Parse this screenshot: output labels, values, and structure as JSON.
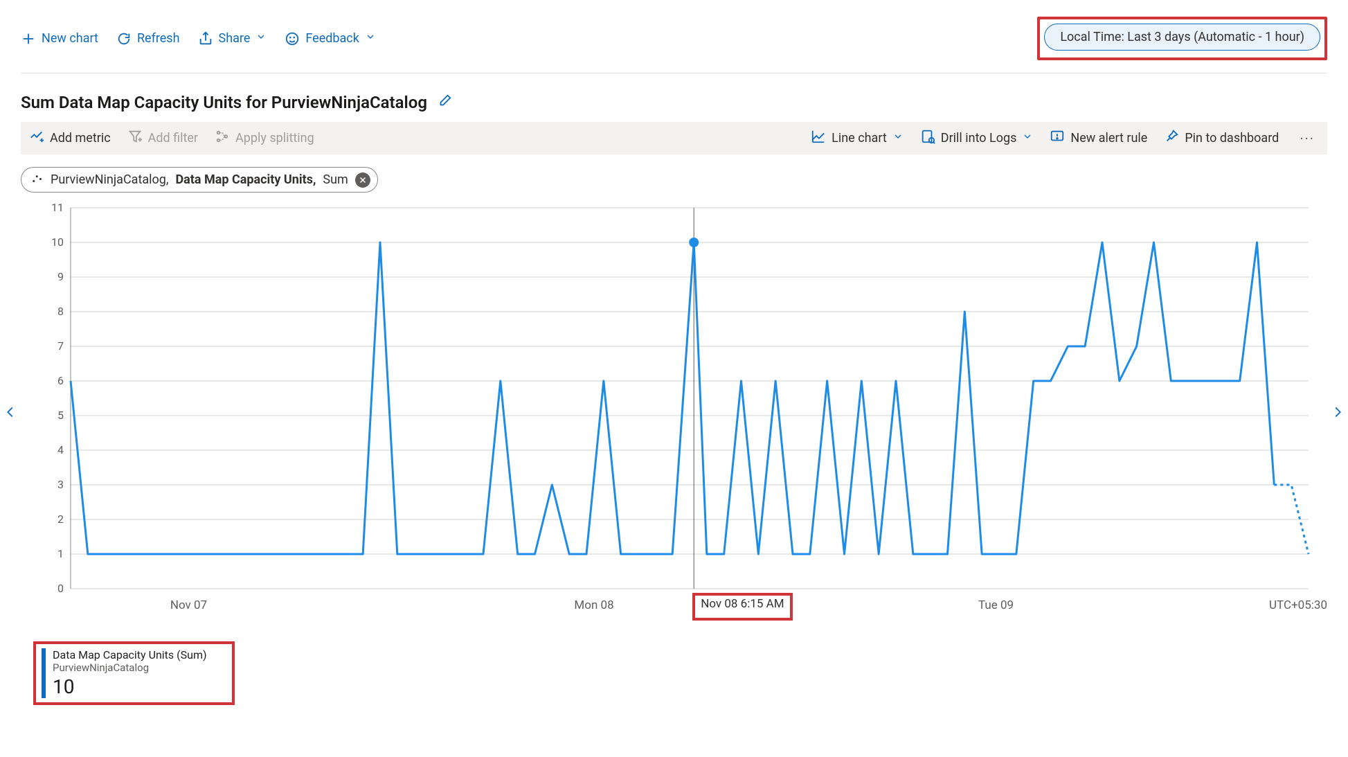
{
  "colors": {
    "accent": "#0f6cbd",
    "danger_box": "#d13438",
    "grid": "#d2d0ce",
    "line": "#1e8be6"
  },
  "top_toolbar": {
    "new_chart_label": "New chart",
    "refresh_label": "Refresh",
    "share_label": "Share",
    "feedback_label": "Feedback",
    "time_picker_label": "Local Time: Last 3 days (Automatic - 1 hour)"
  },
  "title": "Sum Data Map Capacity Units for PurviewNinjaCatalog",
  "secondary_toolbar": {
    "add_metric_label": "Add metric",
    "add_filter_label": "Add filter",
    "apply_splitting_label": "Apply splitting",
    "chart_type_label": "Line chart",
    "drill_logs_label": "Drill into Logs",
    "new_alert_label": "New alert rule",
    "pin_label": "Pin to dashboard"
  },
  "metric_chip": {
    "scope": "PurviewNinjaCatalog, ",
    "metric": "Data Map Capacity Units, ",
    "aggregation": "Sum"
  },
  "hover": {
    "label": "Nov 08 6:15 AM"
  },
  "legend": {
    "title": "Data Map Capacity Units (Sum)",
    "subtitle": "PurviewNinjaCatalog",
    "value": "10"
  },
  "x_axis_labels": {
    "nov07": "Nov 07",
    "mon08": "Mon 08",
    "tue09": "Tue 09",
    "tz": "UTC+05:30"
  },
  "chart_data": {
    "type": "line",
    "title": "Sum Data Map Capacity Units for PurviewNinjaCatalog",
    "xlabel": "",
    "ylabel": "",
    "ylim": [
      0,
      11
    ],
    "y_ticks": [
      0,
      1,
      2,
      3,
      4,
      5,
      6,
      7,
      8,
      9,
      10,
      11
    ],
    "x_range_days": [
      "Nov 06 ~18:00",
      "Nov 09 ~18:00"
    ],
    "timezone": "UTC+05:30",
    "highlight_point": {
      "x_hours": 36.25,
      "y": 10,
      "label": "Nov 08 6:15 AM"
    },
    "series": [
      {
        "name": "Data Map Capacity Units (Sum) — PurviewNinjaCatalog",
        "color": "#1e8be6",
        "x_hours": [
          0,
          1,
          2,
          3,
          4,
          5,
          6,
          7,
          8,
          9,
          10,
          11,
          12,
          13,
          14,
          15,
          16,
          17,
          18,
          19,
          20,
          21,
          22,
          23,
          24,
          25,
          26,
          27,
          28,
          29,
          30,
          31,
          32,
          33,
          34,
          35,
          36.25,
          37,
          38,
          39,
          40,
          41,
          42,
          43,
          44,
          45,
          46,
          47,
          48,
          49,
          50,
          51,
          52,
          53,
          54,
          55,
          56,
          57,
          58,
          59,
          60,
          61,
          62,
          63,
          64,
          65,
          66,
          67,
          68,
          69,
          70,
          71,
          72
        ],
        "values": [
          6,
          1,
          1,
          1,
          1,
          1,
          1,
          1,
          1,
          1,
          1,
          1,
          1,
          1,
          1,
          1,
          1,
          1,
          10,
          1,
          1,
          1,
          1,
          1,
          1,
          6,
          1,
          1,
          3,
          1,
          1,
          6,
          1,
          1,
          1,
          1,
          10,
          1,
          1,
          6,
          1,
          6,
          1,
          1,
          6,
          1,
          6,
          1,
          6,
          1,
          1,
          1,
          8,
          1,
          1,
          1,
          6,
          6,
          7,
          7,
          10,
          6,
          7,
          10,
          6,
          6,
          6,
          6,
          6,
          10,
          3,
          3,
          1
        ]
      }
    ]
  }
}
